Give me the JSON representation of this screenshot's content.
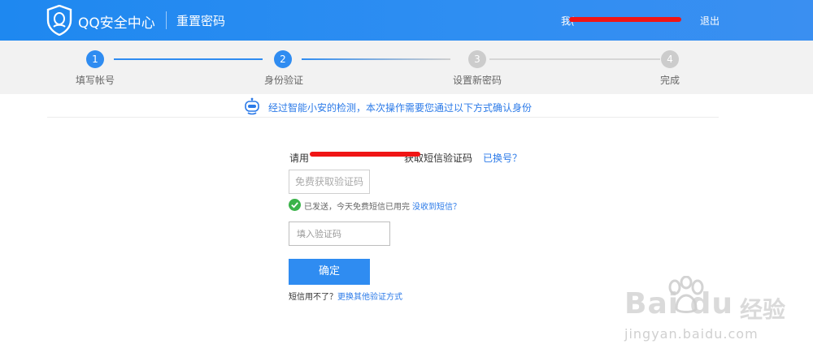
{
  "header": {
    "brand": "QQ安全中心",
    "page_title": "重置密码",
    "account": "我(",
    "logout": "退出"
  },
  "steps": [
    {
      "number": "1",
      "label": "填写帐号",
      "state": "done"
    },
    {
      "number": "2",
      "label": "身份验证",
      "state": "active"
    },
    {
      "number": "3",
      "label": "设置新密码",
      "state": "todo"
    },
    {
      "number": "4",
      "label": "完成",
      "state": "todo"
    }
  ],
  "colors": {
    "primary": "#2f8cf1",
    "link": "#2b7ae8",
    "step_inactive": "#cccccc",
    "success": "#3bb34a",
    "redaction": "#f01515"
  },
  "notice": {
    "icon": "robot-icon",
    "text": "经过智能小安的检测，本次操作需要您通过以下方式确认身份"
  },
  "form": {
    "sms_prefix": "请用",
    "sms_suffix": "获取短信验证码",
    "change_number": "已换号？",
    "get_code_button": "免费获取验证码",
    "sent_status": "已发送，今天免费短信已用完",
    "not_received_link": "没收到短信？",
    "code_placeholder": "填入验证码",
    "code_value": "",
    "confirm_button": "确定",
    "other_prefix": "短信用不了？",
    "other_link": "更换其他验证方式"
  },
  "watermark": {
    "brand": "Bai du",
    "label": "经验",
    "url": "jingyan.baidu.com"
  }
}
